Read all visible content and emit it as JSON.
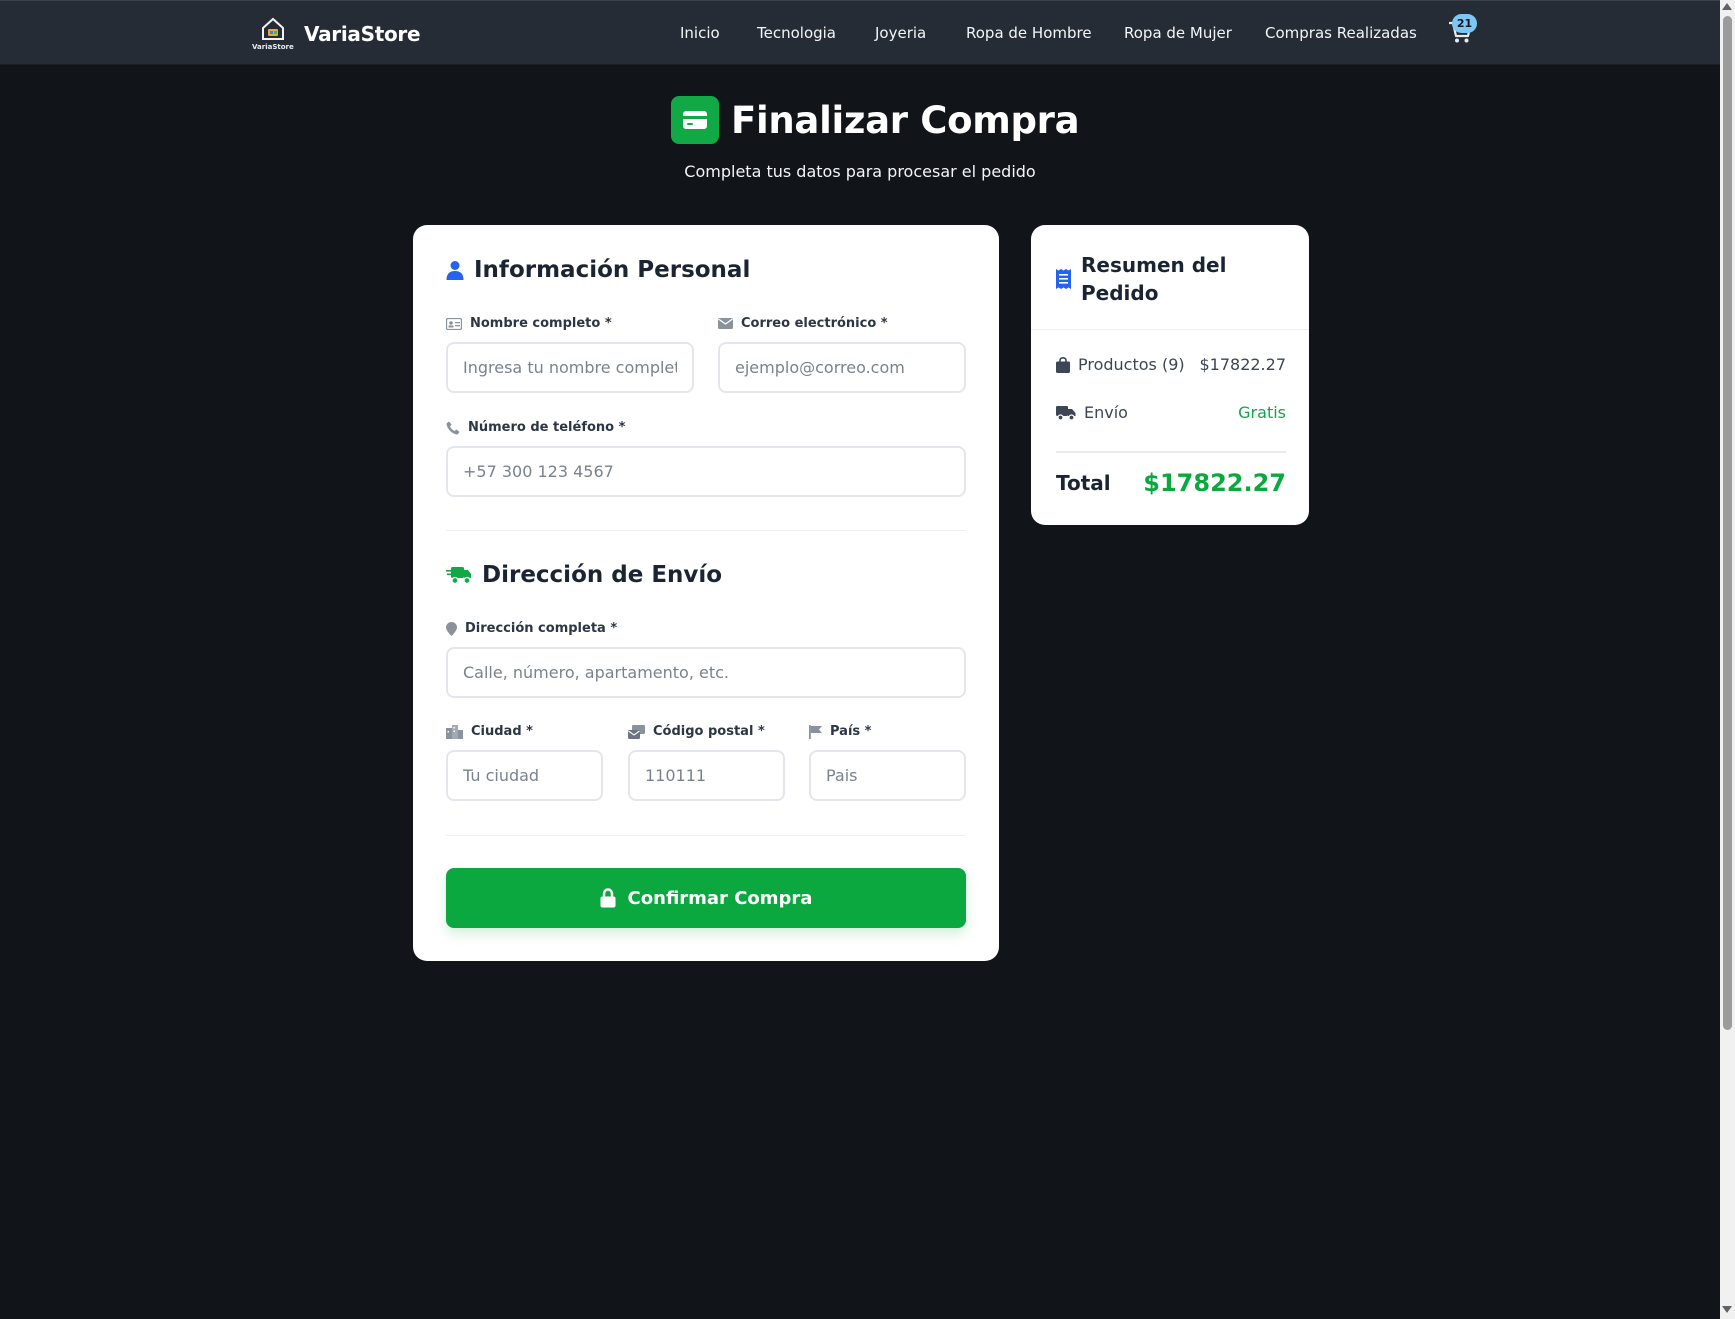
{
  "navbar": {
    "brand_name": "VariaStore",
    "logo_text": "VariaStore",
    "links": [
      "Inicio",
      "Tecnologia",
      "Joyeria",
      "Ropa de Hombre",
      "Ropa de Mujer",
      "Compras Realizadas"
    ],
    "cart_count": "21",
    "cart_icon": "shopping-cart-icon"
  },
  "header": {
    "title": "Finalizar Compra",
    "subtitle": "Completa tus datos para procesar el pedido",
    "icon": "credit-card-icon"
  },
  "personal": {
    "title": "Información Personal",
    "name_label": "Nombre completo *",
    "name_placeholder": "Ingresa tu nombre completo",
    "email_label": "Correo electrónico *",
    "email_placeholder": "ejemplo@correo.com",
    "phone_label": "Número de teléfono *",
    "phone_placeholder": "+57 300 123 4567"
  },
  "shipping": {
    "title": "Dirección de Envío",
    "address_label": "Dirección completa *",
    "address_placeholder": "Calle, número, apartamento, etc.",
    "city_label": "Ciudad *",
    "city_placeholder": "Tu ciudad",
    "postal_label": "Código postal *",
    "postal_placeholder": "110111",
    "country_label": "País *",
    "country_placeholder": "Pais"
  },
  "confirm_label": "Confirmar Compra",
  "summary": {
    "title": "Resumen del Pedido",
    "products_label": "Productos (9)",
    "products_value": "$17822.27",
    "shipping_label": "Envío",
    "shipping_value": "Gratis",
    "total_label": "Total",
    "total_value": "$17822.27"
  },
  "colors": {
    "background": "#111418",
    "navbar": "#262c35",
    "accent_green": "#0aa83f",
    "accent_blue": "#2563eb",
    "badge": "#7dc7f5"
  }
}
